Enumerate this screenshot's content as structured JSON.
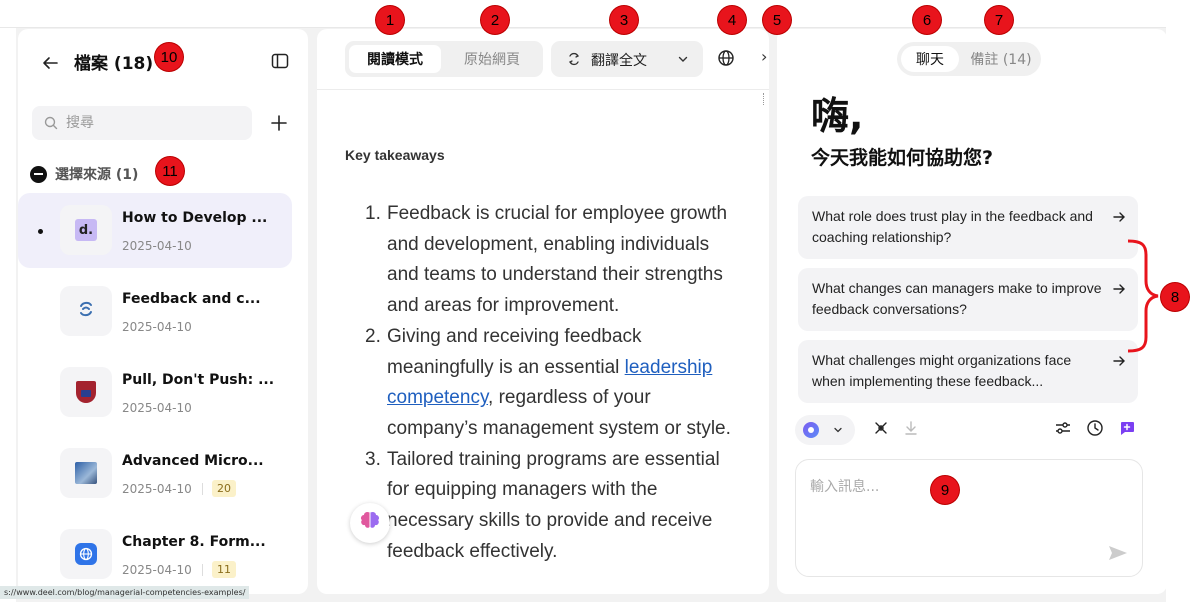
{
  "left": {
    "title": "檔案 (18)",
    "search_placeholder": "搜尋",
    "source_label": "選擇來源 (1)",
    "items": [
      {
        "title": "How to Develop ...",
        "date": "2025-04-10",
        "selected": true,
        "favicon": "d-logo-icon",
        "badge": ""
      },
      {
        "title": "Feedback and c...",
        "date": "2025-04-10",
        "selected": false,
        "favicon": "link-icon",
        "badge": ""
      },
      {
        "title": "Pull, Don't Push: ...",
        "date": "2025-04-10",
        "selected": false,
        "favicon": "shield-icon",
        "badge": ""
      },
      {
        "title": "Advanced Micro...",
        "date": "2025-04-10",
        "selected": false,
        "favicon": "image-icon",
        "badge": "20"
      },
      {
        "title": "Chapter 8. Form...",
        "date": "2025-04-10",
        "selected": false,
        "favicon": "globe-icon",
        "badge": "11"
      }
    ],
    "status_url": "s://www.deel.com/blog/managerial-competencies-examples/"
  },
  "middle": {
    "mode_reading": "閱讀模式",
    "mode_original": "原始網頁",
    "translate_label": "翻譯全文",
    "more_glyph": "›",
    "heading": "Key takeaways",
    "list": [
      {
        "num": "1.",
        "text": "Feedback is crucial for employee growth and development, enabling individuals and teams to understand their strengths and areas for improvement."
      },
      {
        "num": "2.",
        "before": "Giving and receiving feedback meaningfully is an essential ",
        "link": "leadership competency",
        "after": ", regardless of your company’s management system or style."
      },
      {
        "num": "3.",
        "text": "Tailored training programs are essential for equipping managers with the necessary skills to provide and receive feedback effectively."
      }
    ]
  },
  "right": {
    "tab_chat": "聊天",
    "tab_notes": "備註 (14)",
    "greeting": "嗨,",
    "help": "今天我能如何協助您?",
    "suggestions": [
      "What role does trust play in the feedback and coaching relationship?",
      "What changes can managers make to improve feedback conversations?",
      "What challenges might organizations face when implementing these feedback..."
    ],
    "input_placeholder": "輸入訊息..."
  },
  "annotations": [
    "1",
    "2",
    "3",
    "4",
    "5",
    "6",
    "7",
    "8",
    "9",
    "10",
    "11"
  ],
  "colors": {
    "badge_red": "#e8141c",
    "accent_purple": "#7b5cf0",
    "link_blue": "#1f5fbf",
    "selected_bg": "#f0effa"
  }
}
